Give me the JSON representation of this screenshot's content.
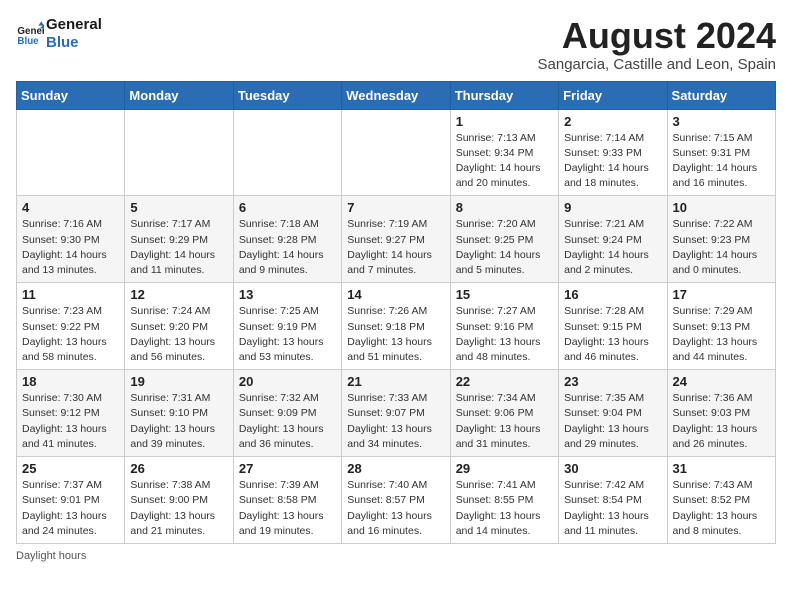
{
  "header": {
    "logo_line1": "General",
    "logo_line2": "Blue",
    "month_year": "August 2024",
    "location": "Sangarcia, Castille and Leon, Spain"
  },
  "weekdays": [
    "Sunday",
    "Monday",
    "Tuesday",
    "Wednesday",
    "Thursday",
    "Friday",
    "Saturday"
  ],
  "weeks": [
    [
      {
        "day": "",
        "info": ""
      },
      {
        "day": "",
        "info": ""
      },
      {
        "day": "",
        "info": ""
      },
      {
        "day": "",
        "info": ""
      },
      {
        "day": "1",
        "info": "Sunrise: 7:13 AM\nSunset: 9:34 PM\nDaylight: 14 hours and 20 minutes."
      },
      {
        "day": "2",
        "info": "Sunrise: 7:14 AM\nSunset: 9:33 PM\nDaylight: 14 hours and 18 minutes."
      },
      {
        "day": "3",
        "info": "Sunrise: 7:15 AM\nSunset: 9:31 PM\nDaylight: 14 hours and 16 minutes."
      }
    ],
    [
      {
        "day": "4",
        "info": "Sunrise: 7:16 AM\nSunset: 9:30 PM\nDaylight: 14 hours and 13 minutes."
      },
      {
        "day": "5",
        "info": "Sunrise: 7:17 AM\nSunset: 9:29 PM\nDaylight: 14 hours and 11 minutes."
      },
      {
        "day": "6",
        "info": "Sunrise: 7:18 AM\nSunset: 9:28 PM\nDaylight: 14 hours and 9 minutes."
      },
      {
        "day": "7",
        "info": "Sunrise: 7:19 AM\nSunset: 9:27 PM\nDaylight: 14 hours and 7 minutes."
      },
      {
        "day": "8",
        "info": "Sunrise: 7:20 AM\nSunset: 9:25 PM\nDaylight: 14 hours and 5 minutes."
      },
      {
        "day": "9",
        "info": "Sunrise: 7:21 AM\nSunset: 9:24 PM\nDaylight: 14 hours and 2 minutes."
      },
      {
        "day": "10",
        "info": "Sunrise: 7:22 AM\nSunset: 9:23 PM\nDaylight: 14 hours and 0 minutes."
      }
    ],
    [
      {
        "day": "11",
        "info": "Sunrise: 7:23 AM\nSunset: 9:22 PM\nDaylight: 13 hours and 58 minutes."
      },
      {
        "day": "12",
        "info": "Sunrise: 7:24 AM\nSunset: 9:20 PM\nDaylight: 13 hours and 56 minutes."
      },
      {
        "day": "13",
        "info": "Sunrise: 7:25 AM\nSunset: 9:19 PM\nDaylight: 13 hours and 53 minutes."
      },
      {
        "day": "14",
        "info": "Sunrise: 7:26 AM\nSunset: 9:18 PM\nDaylight: 13 hours and 51 minutes."
      },
      {
        "day": "15",
        "info": "Sunrise: 7:27 AM\nSunset: 9:16 PM\nDaylight: 13 hours and 48 minutes."
      },
      {
        "day": "16",
        "info": "Sunrise: 7:28 AM\nSunset: 9:15 PM\nDaylight: 13 hours and 46 minutes."
      },
      {
        "day": "17",
        "info": "Sunrise: 7:29 AM\nSunset: 9:13 PM\nDaylight: 13 hours and 44 minutes."
      }
    ],
    [
      {
        "day": "18",
        "info": "Sunrise: 7:30 AM\nSunset: 9:12 PM\nDaylight: 13 hours and 41 minutes."
      },
      {
        "day": "19",
        "info": "Sunrise: 7:31 AM\nSunset: 9:10 PM\nDaylight: 13 hours and 39 minutes."
      },
      {
        "day": "20",
        "info": "Sunrise: 7:32 AM\nSunset: 9:09 PM\nDaylight: 13 hours and 36 minutes."
      },
      {
        "day": "21",
        "info": "Sunrise: 7:33 AM\nSunset: 9:07 PM\nDaylight: 13 hours and 34 minutes."
      },
      {
        "day": "22",
        "info": "Sunrise: 7:34 AM\nSunset: 9:06 PM\nDaylight: 13 hours and 31 minutes."
      },
      {
        "day": "23",
        "info": "Sunrise: 7:35 AM\nSunset: 9:04 PM\nDaylight: 13 hours and 29 minutes."
      },
      {
        "day": "24",
        "info": "Sunrise: 7:36 AM\nSunset: 9:03 PM\nDaylight: 13 hours and 26 minutes."
      }
    ],
    [
      {
        "day": "25",
        "info": "Sunrise: 7:37 AM\nSunset: 9:01 PM\nDaylight: 13 hours and 24 minutes."
      },
      {
        "day": "26",
        "info": "Sunrise: 7:38 AM\nSunset: 9:00 PM\nDaylight: 13 hours and 21 minutes."
      },
      {
        "day": "27",
        "info": "Sunrise: 7:39 AM\nSunset: 8:58 PM\nDaylight: 13 hours and 19 minutes."
      },
      {
        "day": "28",
        "info": "Sunrise: 7:40 AM\nSunset: 8:57 PM\nDaylight: 13 hours and 16 minutes."
      },
      {
        "day": "29",
        "info": "Sunrise: 7:41 AM\nSunset: 8:55 PM\nDaylight: 13 hours and 14 minutes."
      },
      {
        "day": "30",
        "info": "Sunrise: 7:42 AM\nSunset: 8:54 PM\nDaylight: 13 hours and 11 minutes."
      },
      {
        "day": "31",
        "info": "Sunrise: 7:43 AM\nSunset: 8:52 PM\nDaylight: 13 hours and 8 minutes."
      }
    ]
  ],
  "footer": {
    "daylight_label": "Daylight hours"
  }
}
